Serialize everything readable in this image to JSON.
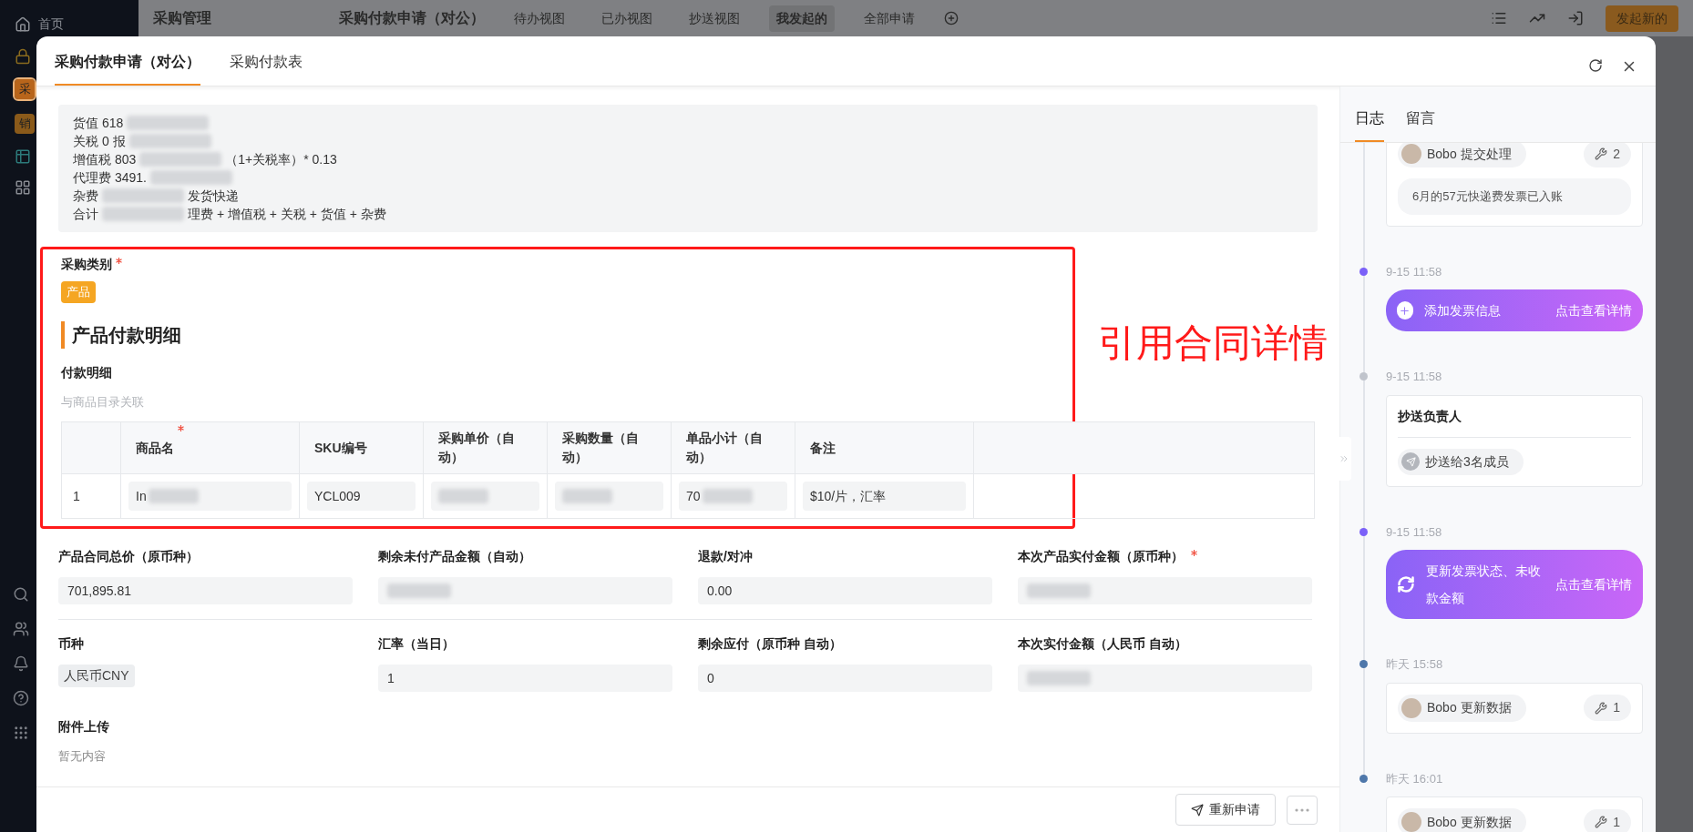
{
  "sidebar": {
    "home": "首页",
    "apps": [
      {
        "label": "采",
        "color": "#b8651b",
        "selected": true
      },
      {
        "label": "销",
        "color": "#8a5a1a",
        "selected": false
      }
    ]
  },
  "topbar": {
    "module": "采购管理",
    "view": "采购付款申请（对公）",
    "views": [
      {
        "label": "待办视图",
        "selected": false
      },
      {
        "label": "已办视图",
        "selected": false
      },
      {
        "label": "抄送视图",
        "selected": false
      },
      {
        "label": "我发起的",
        "selected": true
      },
      {
        "label": "全部申请",
        "selected": false
      }
    ],
    "new_button": "发起新的"
  },
  "modal": {
    "tabs": [
      {
        "label": "采购付款申请（对公）",
        "selected": true
      },
      {
        "label": "采购付款表",
        "selected": false
      }
    ],
    "info_lines": [
      {
        "before": "货值 618"
      },
      {
        "before": "关税 0 报"
      },
      {
        "before": "增值税 803",
        "after": "（1+关税率）* 0.13"
      },
      {
        "before": "代理费 3491."
      },
      {
        "before": "杂费",
        "after": "发货快递"
      },
      {
        "before": "合计",
        "after": "理费 + 增值税 + 关税 + 货值 + 杂费"
      }
    ],
    "category": {
      "label": "采购类别",
      "required": true,
      "tag": "产品"
    },
    "section_title": "产品付款明细",
    "detail": {
      "label": "付款明细",
      "hint": "与商品目录关联",
      "columns": [
        {
          "label": "商品名",
          "required": true
        },
        {
          "label": "SKU编号",
          "required": false
        },
        {
          "label": "采购单价（自动）",
          "required": false
        },
        {
          "label": "采购数量（自动）",
          "required": false
        },
        {
          "label": "单品小计（自动）",
          "required": false
        },
        {
          "label": "备注",
          "required": false
        }
      ],
      "rows": [
        {
          "index": "1",
          "cells": [
            {
              "text": "In",
              "redacted": true
            },
            {
              "text": "YCL009",
              "redacted": false
            },
            {
              "redacted": true
            },
            {
              "redacted": true
            },
            {
              "text": "70",
              "redacted": true
            },
            {
              "text": "$10/片，汇率",
              "redacted": false
            }
          ]
        }
      ]
    },
    "annotation": "引用合同详情",
    "fields": [
      {
        "label": "产品合同总价（原币种）",
        "required": false,
        "kind": "input",
        "value": "701,895.81",
        "redacted": false
      },
      {
        "label": "剩余未付产品金额（自动）",
        "required": false,
        "kind": "input",
        "redacted": true
      },
      {
        "label": "退款/对冲",
        "required": false,
        "kind": "input",
        "value": "0.00",
        "redacted": false
      },
      {
        "label": "本次产品实付金额（原币种）",
        "required": true,
        "kind": "input",
        "redacted": true
      },
      {
        "label": "币种",
        "required": false,
        "kind": "tag",
        "value": "人民币CNY"
      },
      {
        "label": "汇率（当日）",
        "required": false,
        "kind": "input",
        "value": "1",
        "redacted": false
      },
      {
        "label": "剩余应付（原币种 自动）",
        "required": false,
        "kind": "input",
        "value": "0",
        "redacted": false
      },
      {
        "label": "本次实付金额（人民币 自动）",
        "required": false,
        "kind": "input",
        "redacted": true
      }
    ],
    "attachments": {
      "label": "附件上传",
      "empty": "暂无内容"
    },
    "resubmit": "重新申请",
    "side_tabs": [
      {
        "label": "日志",
        "selected": true
      },
      {
        "label": "留言",
        "selected": false
      }
    ],
    "timeline": [
      {
        "kind": "log",
        "label": "Bobo 提交处理",
        "count": "2",
        "note": "6月的57元快递费发票已入账"
      },
      {
        "kind": "add_event",
        "time": "9-15 11:58",
        "color": "#7b61f8",
        "title": "添加发票信息",
        "link": "点击查看详情"
      },
      {
        "kind": "cc",
        "time": "9-15 11:58",
        "color": "#c0c4cc",
        "title": "抄送负责人",
        "chip": "抄送给3名成员"
      },
      {
        "kind": "update_event",
        "time": "9-15 11:58",
        "color": "#7b61f8",
        "title": "更新发票状态、未收款金额",
        "link": "点击查看详情"
      },
      {
        "kind": "log",
        "time": "昨天 15:58",
        "color": "#4e77aa",
        "label": "Bobo 更新数据",
        "count": "1"
      },
      {
        "kind": "log",
        "time": "昨天 16:01",
        "color": "#4e77aa",
        "label": "Bobo 更新数据",
        "count": "1"
      }
    ]
  }
}
